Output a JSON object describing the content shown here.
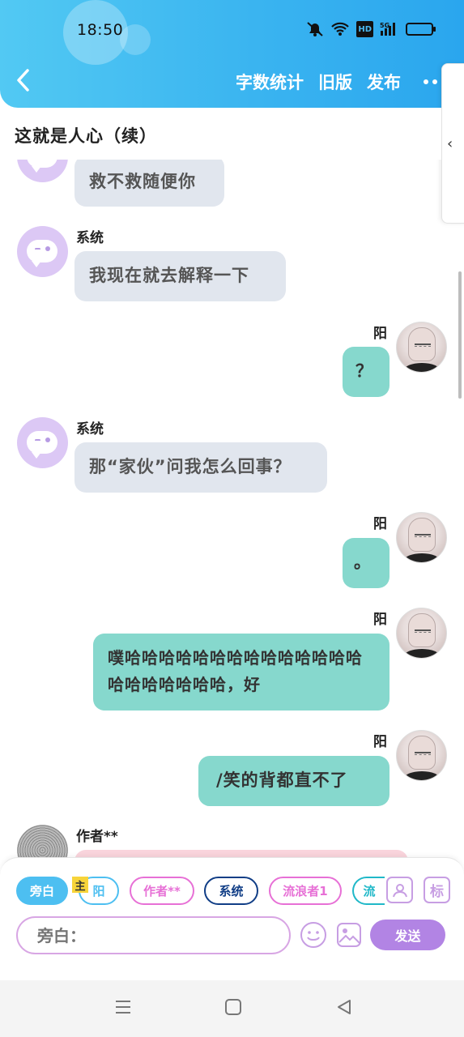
{
  "status_bar": {
    "time": "18:50",
    "hd": "HD",
    "net": "5G"
  },
  "header": {
    "actions": [
      "字数统计",
      "旧版",
      "发布"
    ]
  },
  "title": "这就是人心（续）",
  "messages": [
    {
      "side": "left",
      "speaker": "",
      "text": "救不救随便你"
    },
    {
      "side": "left",
      "speaker": "系统",
      "text": "我现在就去解释一下"
    },
    {
      "side": "right",
      "speaker": "阳",
      "text": "？"
    },
    {
      "side": "left",
      "speaker": "系统",
      "text": "那“家伙”问我怎么回事？"
    },
    {
      "side": "right",
      "speaker": "阳",
      "text": "。"
    },
    {
      "side": "right",
      "speaker": "阳",
      "text": "噗哈哈哈哈哈哈哈哈哈哈哈哈哈哈哈哈哈哈哈哈哈，好"
    },
    {
      "side": "right",
      "speaker": "阳",
      "text": "/笑的背都直不了"
    },
    {
      "side": "left",
      "speaker": "作者**",
      "text": ""
    }
  ],
  "composer": {
    "roles": [
      "旁白",
      "阳",
      "作者**",
      "系统",
      "流浪者1",
      "流"
    ],
    "main_badge": "主",
    "mark_label": "标",
    "input_placeholder": "旁白：",
    "send_label": "发送"
  },
  "colors": {
    "header": "#3ab4f0",
    "bubble_left": "#e1e6ee",
    "bubble_right": "#86d8cd",
    "send": "#b284e4"
  }
}
